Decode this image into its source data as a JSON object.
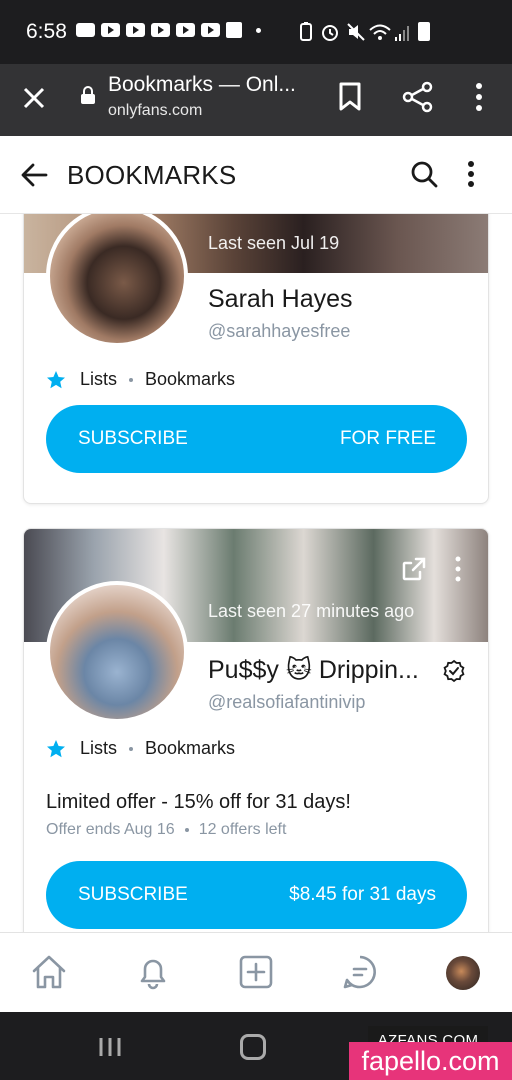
{
  "status_bar": {
    "time": "6:58"
  },
  "browser": {
    "page_title": "Bookmarks — Onl...",
    "url": "onlyfans.com"
  },
  "header": {
    "title": "BOOKMARKS"
  },
  "cards": [
    {
      "last_seen": "Last seen Jul 19",
      "display_name": "Sarah Hayes",
      "handle": "@sarahhayesfree",
      "lists_label": "Lists",
      "bookmarks_label": "Bookmarks",
      "subscribe_label": "SUBSCRIBE",
      "price_label": "FOR FREE"
    },
    {
      "last_seen": "Last seen 27 minutes ago",
      "display_name": "Pu$$y 🐱 Drippin...",
      "handle": "@realsofiafantinivip",
      "lists_label": "Lists",
      "bookmarks_label": "Bookmarks",
      "offer_title": "Limited offer - 15% off for 31 days!",
      "offer_ends": "Offer ends Aug 16",
      "offers_left": "12 offers left",
      "subscribe_label": "SUBSCRIBE",
      "price_label": "$8.45 for 31 days"
    }
  ],
  "bottom_nav": [
    "home-icon",
    "bell-icon",
    "add-post-icon",
    "messages-icon",
    "profile-avatar"
  ],
  "watermarks": {
    "top": "AZFANS.COM",
    "bottom": "fapello.com"
  },
  "colors": {
    "accent": "#00aff0",
    "status_bar": "#1d1d1f",
    "browser_bar": "#333335",
    "muted_text": "#8a96a3"
  }
}
